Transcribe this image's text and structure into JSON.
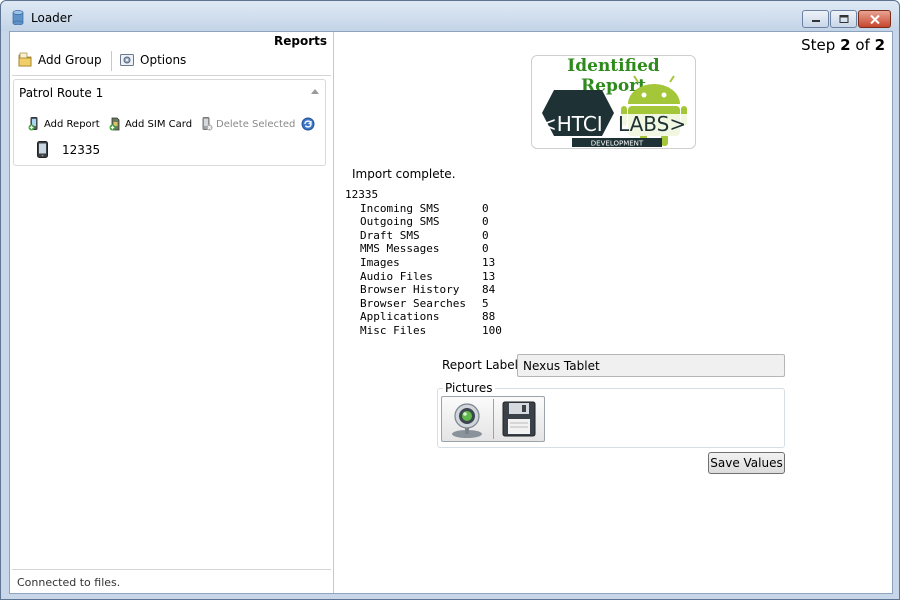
{
  "window": {
    "title": "Loader"
  },
  "left": {
    "heading": "Reports",
    "toolbar": {
      "add_group": "Add Group",
      "options": "Options"
    },
    "group": {
      "title": "Patrol Route 1",
      "actions": {
        "add_report": "Add Report",
        "add_sim": "Add SIM Card",
        "delete_selected": "Delete Selected"
      },
      "devices": [
        {
          "id": "12335"
        }
      ]
    },
    "status": "Connected to files."
  },
  "right": {
    "step": {
      "prefix": "Step",
      "current": "2",
      "of": "of",
      "total": "2"
    },
    "logo": {
      "title": "Identified Report",
      "brand_left": "<HTCI",
      "brand_right": "LABS>",
      "tagline": "DEVELOPMENT"
    },
    "import_message": "Import complete.",
    "report": {
      "id": "12335",
      "stats": [
        {
          "label": "Incoming SMS",
          "value": "0"
        },
        {
          "label": "Outgoing SMS",
          "value": "0"
        },
        {
          "label": "Draft SMS",
          "value": "0"
        },
        {
          "label": "MMS Messages",
          "value": "0"
        },
        {
          "label": "Images",
          "value": "13"
        },
        {
          "label": "Audio Files",
          "value": "13"
        },
        {
          "label": "Browser History",
          "value": "84"
        },
        {
          "label": "Browser Searches",
          "value": "5"
        },
        {
          "label": "Applications",
          "value": "88"
        },
        {
          "label": "Misc Files",
          "value": "100"
        }
      ]
    },
    "report_label": {
      "caption": "Report Label",
      "value": "Nexus Tablet"
    },
    "pictures": {
      "legend": "Pictures"
    },
    "save_button": "Save Values"
  },
  "colors": {
    "logo_title": "#2f8a1c",
    "android_green": "#a4c639",
    "htci_dark": "#1e3236",
    "title_bar": "#c3d4e7"
  },
  "icons": [
    "database-icon",
    "minimize-icon",
    "maximize-icon",
    "close-icon",
    "folder-add-icon",
    "options-icon",
    "add-report-icon",
    "add-sim-icon",
    "delete-icon",
    "refresh-icon",
    "phone-icon",
    "webcam-icon",
    "floppy-disk-icon"
  ]
}
